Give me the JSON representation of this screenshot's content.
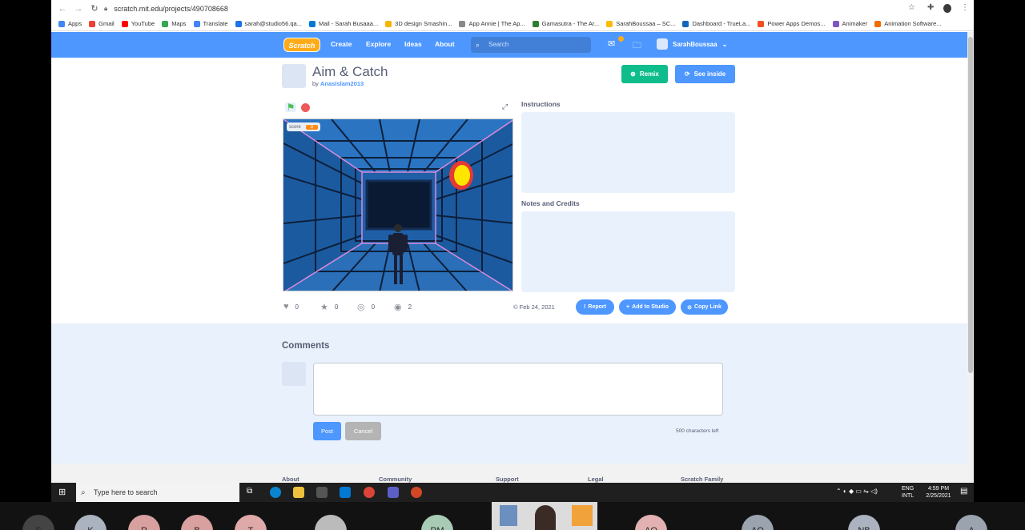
{
  "browser": {
    "url": "scratch.mit.edu/projects/490708668",
    "bookmarks": [
      "Apps",
      "Gmail",
      "YouTube",
      "Maps",
      "Translate",
      "sarah@studio56.qa...",
      "Mail - Sarah Busaaa...",
      "3D design Smashin...",
      "App Annie | The Ap...",
      "Gamasutra - The Ar...",
      "SarahBoussaa – SC...",
      "Dashboard - TrueLa...",
      "Power Apps Demos...",
      "Animaker",
      "Animation Software..."
    ]
  },
  "scratch": {
    "logo": "Scratch",
    "nav": {
      "create": "Create",
      "explore": "Explore",
      "ideas": "Ideas",
      "about": "About"
    },
    "search_placeholder": "Search",
    "username": "SarahBoussaa",
    "project": {
      "title": "Aim & Catch",
      "by_prefix": "by",
      "author": "AnasIslam2013",
      "remix": "Remix",
      "see_inside": "See inside",
      "score_label": "score",
      "score_value": "0",
      "instructions_label": "Instructions",
      "notes_label": "Notes and Credits",
      "stats": {
        "loves": "0",
        "favorites": "0",
        "remixes": "0",
        "views": "2"
      },
      "date": "Feb 24, 2021",
      "report": "Report",
      "add_to_studio": "Add to Studio",
      "copy_link": "Copy Link"
    },
    "comments": {
      "title": "Comments",
      "post": "Post",
      "cancel": "Cancel",
      "chars_left": "500 characters left"
    },
    "footer": [
      "About",
      "Community",
      "Support",
      "Legal",
      "Scratch Family"
    ]
  },
  "taskbar": {
    "search_placeholder": "Type here to search",
    "lang_top": "ENG",
    "lang_bottom": "INTL",
    "time": "4:59 PM",
    "date": "2/25/2021"
  },
  "zoom": {
    "participants": [
      "S",
      "K",
      "R",
      "B",
      "T",
      "",
      "RM",
      "AO",
      "AQ",
      "NB",
      "A"
    ]
  }
}
